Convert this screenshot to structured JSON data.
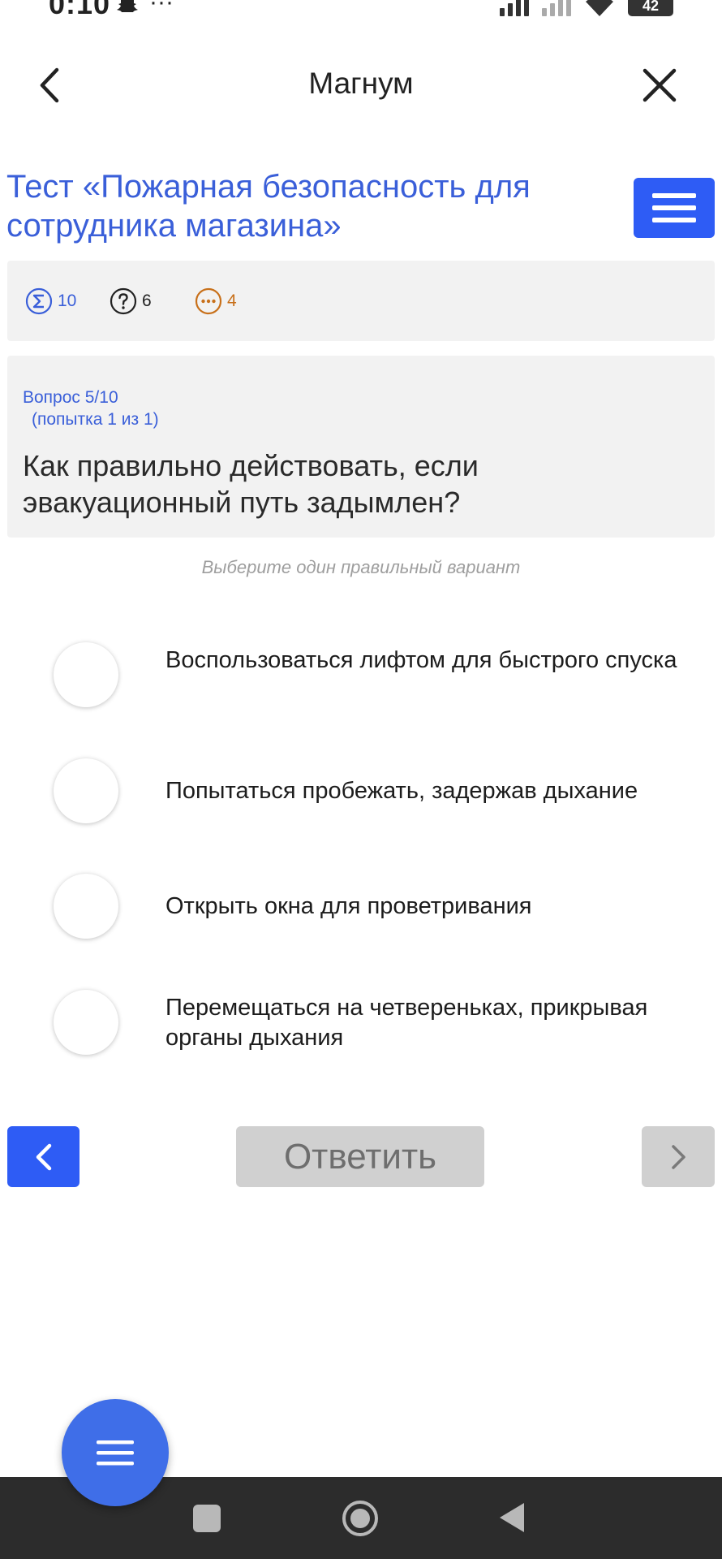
{
  "status_bar": {
    "time": "0:10",
    "dots": "···",
    "battery": "42"
  },
  "header": {
    "title": "Магнум"
  },
  "test": {
    "title": " Тест «Пожарная безопасность для сотрудника магазина»"
  },
  "stats": {
    "total": "10",
    "questions": "6",
    "pending": "4"
  },
  "question": {
    "number": "Вопрос 5/10",
    "attempt": "(попытка 1 из 1)",
    "text": "Как правильно действовать, если эвакуационный путь задымлен?",
    "hint": "Выберите один правильный вариант"
  },
  "options": [
    {
      "label": "Воспользоваться лифтом для быстрого спуска"
    },
    {
      "label": "Попытаться пробежать, задержав дыхание"
    },
    {
      "label": "Открыть окна для проветривания"
    },
    {
      "label": "Перемещаться на четвереньках, прикрывая органы дыхания"
    }
  ],
  "nav": {
    "answer_label": "Ответить"
  },
  "colors": {
    "accent": "#2e5cf5",
    "title": "#3a5fd9",
    "pending": "#c8701a",
    "disabled": "#d0d0d0"
  },
  "icons": {
    "back": "chevron-left-icon",
    "close": "close-icon",
    "menu": "hamburger-icon",
    "total": "sigma-icon",
    "questions": "question-circle-icon",
    "pending": "ellipsis-circle-icon"
  }
}
